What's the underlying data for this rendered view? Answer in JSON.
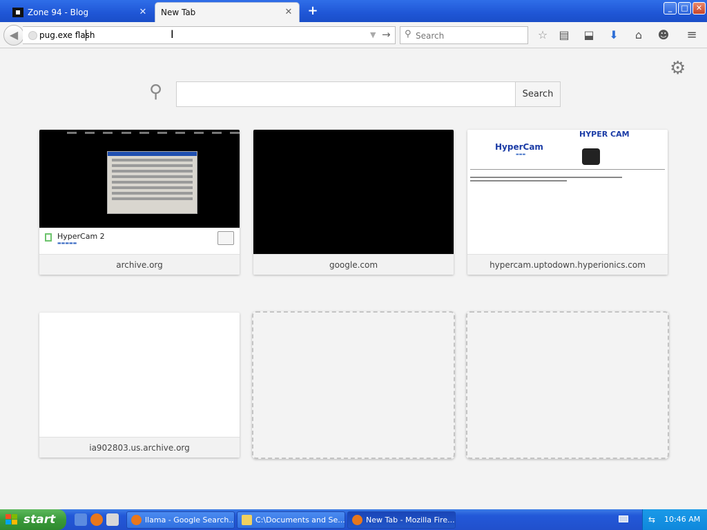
{
  "window": {
    "tabs": [
      {
        "label": "Zone 94 - Blog",
        "active": false
      },
      {
        "label": "New Tab",
        "active": true
      }
    ],
    "new_tab_symbol": "+",
    "controls": {
      "minimize": "_",
      "maximize": "□",
      "close": "✕"
    }
  },
  "navbar": {
    "url_value": "pug.exe flash",
    "search_placeholder": "Search",
    "icons": [
      "back-icon",
      "globe-icon",
      "dropdown-icon",
      "go-arrow-icon",
      "search-icon",
      "bookmark-star-icon",
      "library-icon",
      "pocket-icon",
      "download-icon",
      "home-icon",
      "social-icon",
      "menu-icon"
    ]
  },
  "newtab": {
    "search_button_label": "Search",
    "tiles": [
      {
        "label": "archive.org",
        "thumb_title": "HyperCam 2"
      },
      {
        "label": "google.com"
      },
      {
        "label": "hypercam.uptodown.hyperionics.com",
        "thumb_logo": "HyperCam",
        "thumb_brand": "HYPER CAM"
      },
      {
        "label": "ia902803.us.archive.org"
      }
    ]
  },
  "taskbar": {
    "start_label": "start",
    "tasks": [
      {
        "label": "llama - Google Search...",
        "active": false
      },
      {
        "label": "C:\\Documents and Se...",
        "active": false
      },
      {
        "label": "New Tab - Mozilla Fire...",
        "active": true
      }
    ],
    "clock": "10:46 AM"
  },
  "colors": {
    "titlebar": "#1f56d6",
    "taskbar": "#2150cc",
    "start_button": "#3a9a3a",
    "content_bg": "#f3f3f3"
  }
}
